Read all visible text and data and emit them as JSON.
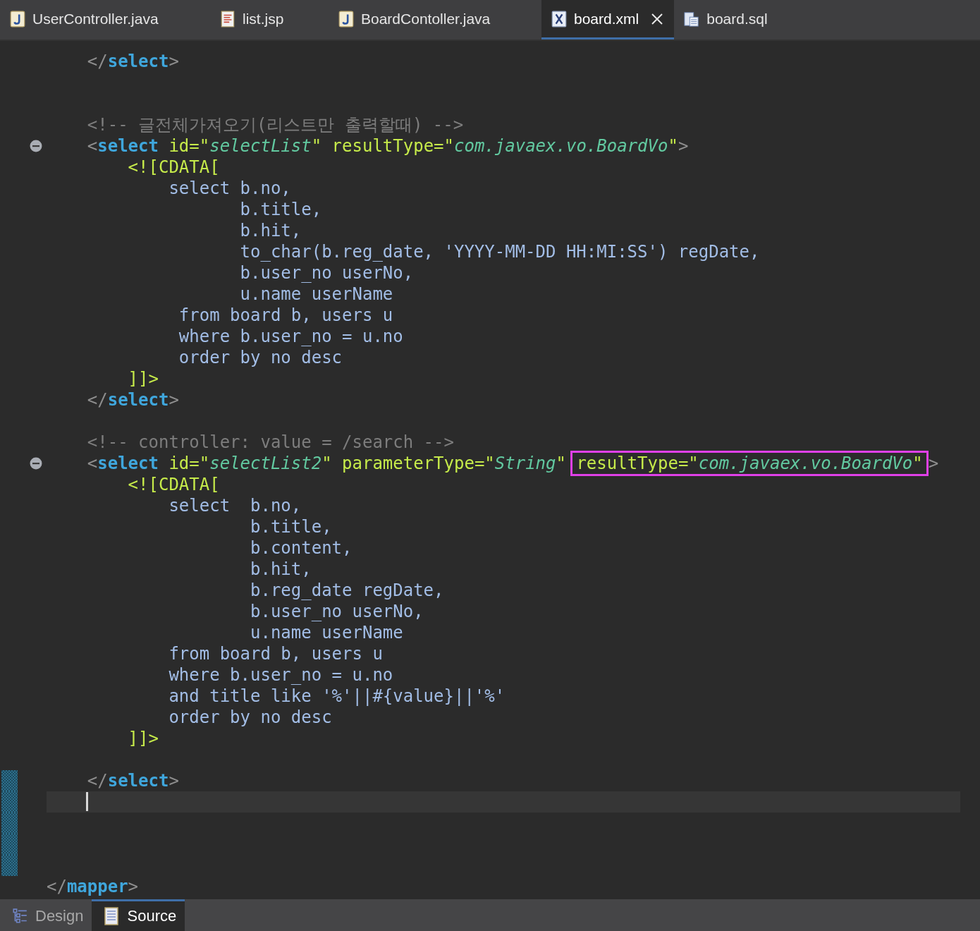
{
  "tabs": [
    {
      "label": "UserController.java",
      "kind": "java",
      "selected": false
    },
    {
      "label": "list.jsp",
      "kind": "jsp",
      "selected": false
    },
    {
      "label": "BoardContoller.java",
      "kind": "java",
      "selected": false
    },
    {
      "label": "board.xml",
      "kind": "xml",
      "selected": true
    },
    {
      "label": "board.sql",
      "kind": "sql",
      "selected": false
    }
  ],
  "lines": [
    {
      "kind": "code",
      "fold": false,
      "changed": false,
      "segments": [
        {
          "kind": "punct",
          "text": "    </"
        },
        {
          "kind": "tag",
          "text": "select"
        },
        {
          "kind": "punct",
          "text": ">"
        }
      ]
    },
    {
      "kind": "blank",
      "fold": false,
      "changed": false
    },
    {
      "kind": "blank",
      "fold": false,
      "changed": false
    },
    {
      "kind": "code",
      "fold": false,
      "changed": false,
      "segments": [
        {
          "kind": "comment",
          "text": "    <!-- 글전체가져오기(리스트만 출력할때) -->"
        }
      ]
    },
    {
      "kind": "code",
      "fold": true,
      "changed": false,
      "segments": [
        {
          "kind": "punct",
          "text": "    <"
        },
        {
          "kind": "tag",
          "text": "select"
        },
        {
          "kind": "attr",
          "text": " id=\""
        },
        {
          "kind": "value",
          "text": "selectList"
        },
        {
          "kind": "attr",
          "text": "\" resultType=\""
        },
        {
          "kind": "value",
          "text": "com.javaex.vo.BoardVo"
        },
        {
          "kind": "attr",
          "text": "\""
        },
        {
          "kind": "punct",
          "text": ">"
        }
      ]
    },
    {
      "kind": "code",
      "fold": false,
      "changed": false,
      "segments": [
        {
          "kind": "cdata",
          "text": "        <![CDATA["
        }
      ]
    },
    {
      "kind": "code",
      "fold": false,
      "changed": false,
      "segments": [
        {
          "kind": "sql",
          "text": "            select b.no,"
        }
      ]
    },
    {
      "kind": "code",
      "fold": false,
      "changed": false,
      "segments": [
        {
          "kind": "sql",
          "text": "                   b.title,"
        }
      ]
    },
    {
      "kind": "code",
      "fold": false,
      "changed": false,
      "segments": [
        {
          "kind": "sql",
          "text": "                   b.hit,"
        }
      ]
    },
    {
      "kind": "code",
      "fold": false,
      "changed": false,
      "segments": [
        {
          "kind": "sql",
          "text": "                   to_char(b.reg_date, 'YYYY-MM-DD HH:MI:SS') regDate,"
        }
      ]
    },
    {
      "kind": "code",
      "fold": false,
      "changed": false,
      "segments": [
        {
          "kind": "sql",
          "text": "                   b.user_no userNo,"
        }
      ]
    },
    {
      "kind": "code",
      "fold": false,
      "changed": false,
      "segments": [
        {
          "kind": "sql",
          "text": "                   u.name userName"
        }
      ]
    },
    {
      "kind": "code",
      "fold": false,
      "changed": false,
      "segments": [
        {
          "kind": "sql",
          "text": "             from board b, users u"
        }
      ]
    },
    {
      "kind": "code",
      "fold": false,
      "changed": false,
      "segments": [
        {
          "kind": "sql",
          "text": "             where b.user_no = u.no"
        }
      ]
    },
    {
      "kind": "code",
      "fold": false,
      "changed": false,
      "segments": [
        {
          "kind": "sql",
          "text": "             order by no desc"
        }
      ]
    },
    {
      "kind": "code",
      "fold": false,
      "changed": false,
      "segments": [
        {
          "kind": "cdata",
          "text": "        ]]>"
        }
      ]
    },
    {
      "kind": "code",
      "fold": false,
      "changed": false,
      "segments": [
        {
          "kind": "punct",
          "text": "    </"
        },
        {
          "kind": "tag",
          "text": "select"
        },
        {
          "kind": "punct",
          "text": ">"
        }
      ]
    },
    {
      "kind": "blank",
      "fold": false,
      "changed": false
    },
    {
      "kind": "code",
      "fold": false,
      "changed": false,
      "segments": [
        {
          "kind": "comment",
          "text": "    <!-- controller: value = /search -->"
        }
      ]
    },
    {
      "kind": "code",
      "fold": true,
      "changed": false,
      "segments": [
        {
          "kind": "punct",
          "text": "    <"
        },
        {
          "kind": "tag",
          "text": "select"
        },
        {
          "kind": "attr",
          "text": " id=\""
        },
        {
          "kind": "value",
          "text": "selectList2"
        },
        {
          "kind": "attr",
          "text": "\" parameterType=\""
        },
        {
          "kind": "value",
          "text": "String"
        },
        {
          "kind": "attr",
          "text": "\" "
        },
        {
          "kind": "highlight",
          "segments": [
            {
              "kind": "attr",
              "text": "resultType=\""
            },
            {
              "kind": "value",
              "text": "com.javaex.vo.BoardVo"
            },
            {
              "kind": "attr",
              "text": "\""
            }
          ]
        },
        {
          "kind": "punct",
          "text": ">"
        }
      ]
    },
    {
      "kind": "code",
      "fold": false,
      "changed": false,
      "segments": [
        {
          "kind": "cdata",
          "text": "        <![CDATA["
        }
      ]
    },
    {
      "kind": "code",
      "fold": false,
      "changed": false,
      "segments": [
        {
          "kind": "sql",
          "text": "            select  b.no,"
        }
      ]
    },
    {
      "kind": "code",
      "fold": false,
      "changed": false,
      "segments": [
        {
          "kind": "sql",
          "text": "                    b.title,"
        }
      ]
    },
    {
      "kind": "code",
      "fold": false,
      "changed": false,
      "segments": [
        {
          "kind": "sql",
          "text": "                    b.content,"
        }
      ]
    },
    {
      "kind": "code",
      "fold": false,
      "changed": false,
      "segments": [
        {
          "kind": "sql",
          "text": "                    b.hit,"
        }
      ]
    },
    {
      "kind": "code",
      "fold": false,
      "changed": false,
      "segments": [
        {
          "kind": "sql",
          "text": "                    b.reg_date regDate,"
        }
      ]
    },
    {
      "kind": "code",
      "fold": false,
      "changed": false,
      "segments": [
        {
          "kind": "sql",
          "text": "                    b.user_no userNo,"
        }
      ]
    },
    {
      "kind": "code",
      "fold": false,
      "changed": false,
      "segments": [
        {
          "kind": "sql",
          "text": "                    u.name userName"
        }
      ]
    },
    {
      "kind": "code",
      "fold": false,
      "changed": false,
      "segments": [
        {
          "kind": "sql",
          "text": "            from board b, users u"
        }
      ]
    },
    {
      "kind": "code",
      "fold": false,
      "changed": false,
      "segments": [
        {
          "kind": "sql",
          "text": "            where b.user_no = u.no"
        }
      ]
    },
    {
      "kind": "code",
      "fold": false,
      "changed": false,
      "segments": [
        {
          "kind": "sql",
          "text": "            and title like '%'||#{value}||'%'"
        }
      ]
    },
    {
      "kind": "code",
      "fold": false,
      "changed": false,
      "segments": [
        {
          "kind": "sql",
          "text": "            order by no desc"
        }
      ]
    },
    {
      "kind": "code",
      "fold": false,
      "changed": false,
      "segments": [
        {
          "kind": "cdata",
          "text": "        ]]>"
        }
      ]
    },
    {
      "kind": "blank",
      "fold": false,
      "changed": false
    },
    {
      "kind": "code",
      "fold": false,
      "changed": true,
      "segments": [
        {
          "kind": "punct",
          "text": "    </"
        },
        {
          "kind": "tag",
          "text": "select"
        },
        {
          "kind": "punct",
          "text": ">"
        }
      ]
    },
    {
      "kind": "cursor",
      "fold": false,
      "changed": true
    },
    {
      "kind": "blank",
      "fold": false,
      "changed": true
    },
    {
      "kind": "blank",
      "fold": false,
      "changed": true
    },
    {
      "kind": "blank",
      "fold": false,
      "changed": true
    },
    {
      "kind": "code",
      "fold": false,
      "changed": false,
      "segments": [
        {
          "kind": "punct",
          "text": "</"
        },
        {
          "kind": "tag",
          "text": "mapper"
        },
        {
          "kind": "punct",
          "text": ">"
        }
      ]
    }
  ],
  "bottom_tabs": [
    {
      "label": "Design",
      "kind": "design",
      "selected": false
    },
    {
      "label": "Source",
      "kind": "source",
      "selected": true
    }
  ]
}
